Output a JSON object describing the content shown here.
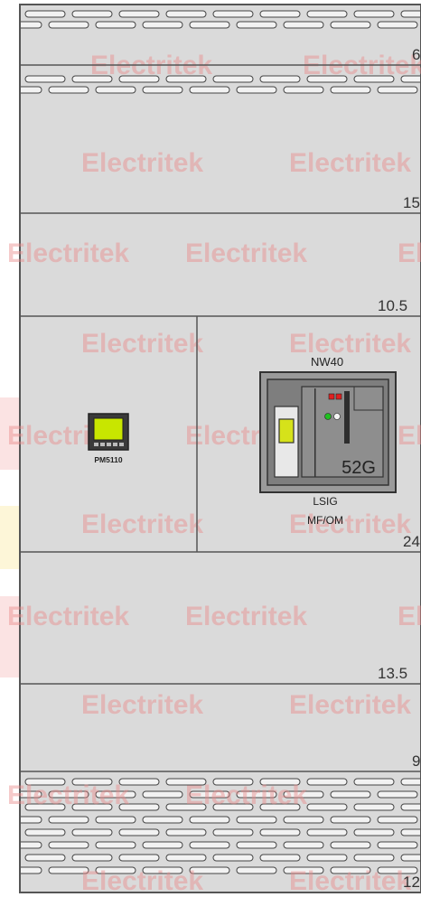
{
  "watermark": {
    "text": "Electritek",
    "color": "#e88a8a"
  },
  "dimensions": {
    "vent_top": "6",
    "section_1": "15",
    "section_2": "10.5",
    "device_section": "24",
    "section_4": "13.5",
    "section_5": "9",
    "vent_bottom": "12"
  },
  "meter": {
    "label": "PM5110"
  },
  "breaker": {
    "model": "NW40",
    "id": "52G",
    "trip_unit": "LSIG",
    "operation": "MF/OM"
  },
  "colors": {
    "panel": "#dadada",
    "line": "#555555",
    "vent": "#f2f2f2",
    "breaker_body": "#8a8a8a",
    "meter_screen": "#c8e600",
    "handle": "#d6e21a",
    "led_red": "#e02020",
    "led_green": "#20c020"
  }
}
